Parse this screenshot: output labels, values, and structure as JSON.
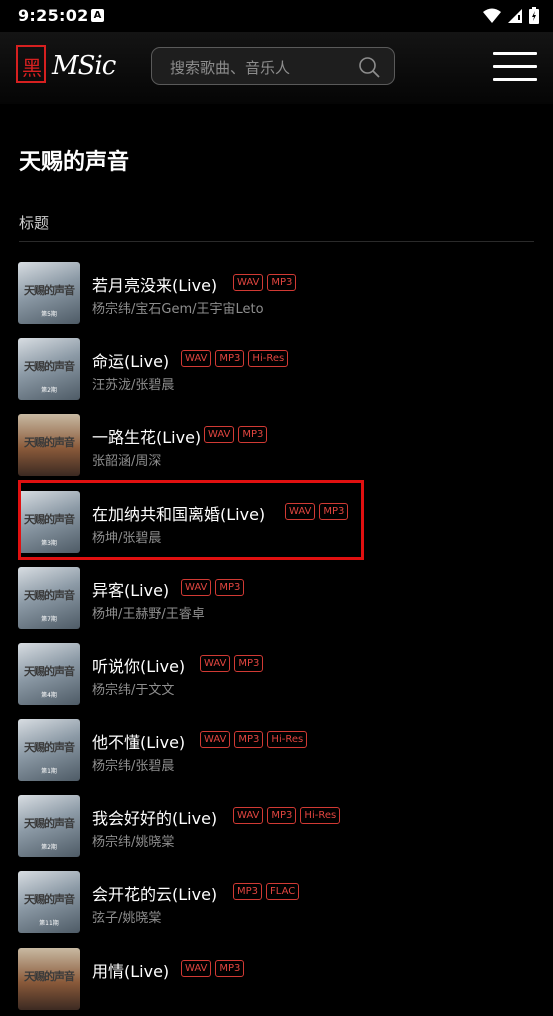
{
  "status": {
    "time": "9:25:02",
    "notif_icon": "A"
  },
  "header": {
    "logo_char": "黑",
    "logo_text": "MSic",
    "search_placeholder": "搜索歌曲、音乐人"
  },
  "page": {
    "title": "天赐的声音",
    "column_header": "标题"
  },
  "songs": [
    {
      "title": "若月亮没来(Live)",
      "artist": "杨宗纬/宝石Gem/王宇宙Leto",
      "tags": [
        "WAV",
        "MP3"
      ],
      "cover": "天赐的声音 第5期"
    },
    {
      "title": "命运(Live)",
      "artist": "汪苏泷/张碧晨",
      "tags": [
        "WAV",
        "MP3",
        "Hi-Res"
      ],
      "cover": "天赐的声音 第2期"
    },
    {
      "title": "一路生花(Live)",
      "artist": "张韶涵/周深",
      "tags": [
        "WAV",
        "MP3"
      ],
      "cover": "天赐的声音"
    },
    {
      "title": "在加纳共和国离婚(Live)",
      "artist": "杨坤/张碧晨",
      "tags": [
        "WAV",
        "MP3"
      ],
      "cover": "天赐的声音 第3期"
    },
    {
      "title": "异客(Live)",
      "artist": "杨坤/王赫野/王睿卓",
      "tags": [
        "WAV",
        "MP3"
      ],
      "cover": "天赐的声音 第7期"
    },
    {
      "title": "听说你(Live)",
      "artist": "杨宗纬/于文文",
      "tags": [
        "WAV",
        "MP3"
      ],
      "cover": "天赐的声音 第4期"
    },
    {
      "title": "他不懂(Live)",
      "artist": "杨宗纬/张碧晨",
      "tags": [
        "WAV",
        "MP3",
        "Hi-Res"
      ],
      "cover": "天赐的声音 第1期"
    },
    {
      "title": "我会好好的(Live)",
      "artist": "杨宗纬/姚晓棠",
      "tags": [
        "WAV",
        "MP3",
        "Hi-Res"
      ],
      "cover": "天赐的声音 第2期"
    },
    {
      "title": "会开花的云(Live)",
      "artist": "弦子/姚晓棠",
      "tags": [
        "MP3",
        "FLAC"
      ],
      "cover": "天赐的声音 第11期"
    },
    {
      "title": "用情(Live)",
      "artist": "",
      "tags": [
        "WAV",
        "MP3"
      ],
      "cover": "天赐的声音"
    }
  ],
  "colors": {
    "accent_red": "#e01010",
    "tag_red": "#e0453f"
  }
}
